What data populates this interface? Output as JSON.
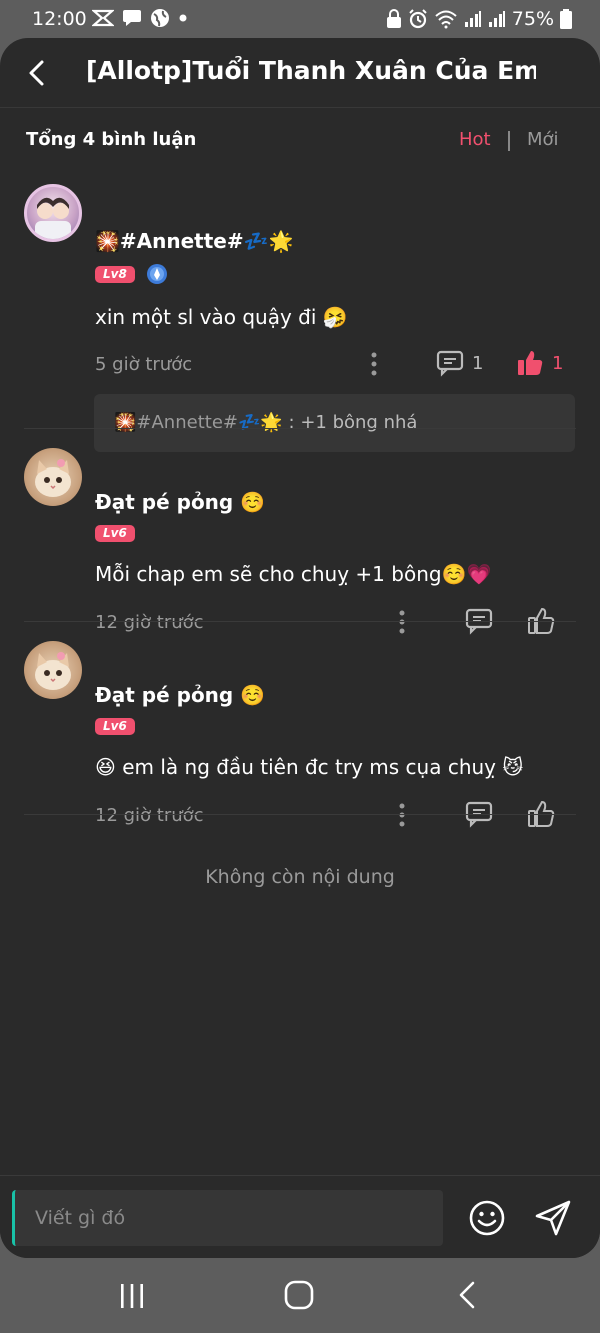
{
  "status_bar": {
    "time": "12:00",
    "battery": "75%",
    "left_icons": [
      "capcut-icon",
      "message-icon",
      "globe-icon",
      "dot-icon"
    ],
    "right_icons": [
      "lock-icon",
      "alarm-icon",
      "wifi-icon",
      "signal-icon",
      "signal-icon",
      "battery-icon"
    ]
  },
  "header": {
    "title": "[Allotp]Tuổi Thanh Xuân Của Em..."
  },
  "sort_bar": {
    "total_label": "Tổng 4 bình luận",
    "hot_label": "Hot",
    "new_label": "Mới",
    "active": "Hot"
  },
  "comments": [
    {
      "username": "🎇#Annette#💤🌟",
      "level": "Lv8",
      "text": "xin một sl vào quậy đi 🤧",
      "time": "5 giờ trước",
      "reply_count": "1",
      "like_count": "1",
      "liked": true,
      "reply": {
        "author": "🎇#Annette#💤🌟",
        "separator": " : ",
        "text": "+1 bông nhá"
      }
    },
    {
      "username": "Đạt pé pỏng ☺️",
      "level": "Lv6",
      "text": "Mỗi chap em sẽ cho chuỵ +1 bông☺️💗",
      "time": "12 giờ trước"
    },
    {
      "username": "Đạt pé pỏng ☺️",
      "level": "Lv6",
      "text": "😆 em là ng đầu tiên đc try ms cụa chuỵ 😼",
      "time": "12 giờ trước"
    }
  ],
  "end_message": "Không còn nội dung",
  "composer": {
    "placeholder": "Viết gì đó"
  },
  "colors": {
    "accent": "#f0506e",
    "background": "#2a2a2a",
    "reply_box": "#363636",
    "muted_text": "#9a9a9a",
    "cursor": "#19c2a8"
  }
}
